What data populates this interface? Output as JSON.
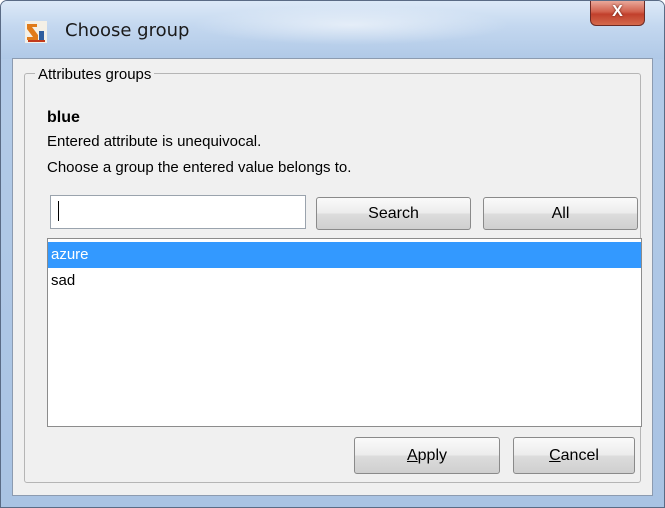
{
  "window": {
    "title": "Choose group",
    "close_label": "X"
  },
  "group": {
    "legend": "Attributes groups",
    "value": "blue",
    "message_line1": "Entered attribute is unequivocal.",
    "message_line2": "Choose a group the entered value belongs to."
  },
  "search": {
    "value": "",
    "placeholder": "",
    "search_label": "Search",
    "all_label": "All"
  },
  "list": {
    "items": [
      {
        "label": "azure",
        "selected": true
      },
      {
        "label": "sad",
        "selected": false
      }
    ],
    "selected_color": "#3399ff"
  },
  "actions": {
    "apply_mnemonic": "A",
    "apply_rest": "pply",
    "cancel_mnemonic": "C",
    "cancel_rest": "ancel"
  },
  "colors": {
    "titlebar": "#c3d7ef",
    "close_button": "#c1402c",
    "dialog_background": "#f0f0f0"
  }
}
